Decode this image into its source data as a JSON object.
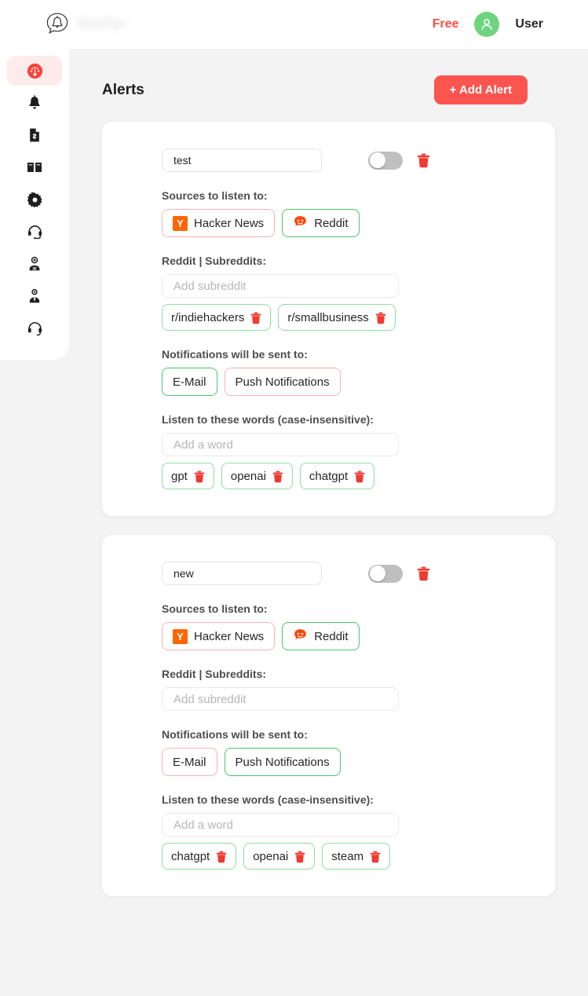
{
  "header": {
    "brand_name": "Notifyr",
    "logo_icon": "bell-in-speech-bubble-icon",
    "plan_label": "Free",
    "user_name": "User",
    "avatar_icon": "user-avatar-icon",
    "avatar_color": "#6fd47f",
    "plan_color": "#fb4e49"
  },
  "sidebar": {
    "items": [
      {
        "name": "dashboard",
        "icon": "gauge-icon",
        "active": true
      },
      {
        "name": "alerts",
        "icon": "bell-icon",
        "active": false
      },
      {
        "name": "billing",
        "icon": "invoice-dollar-icon",
        "active": false
      },
      {
        "name": "docs",
        "icon": "open-book-icon",
        "active": false
      },
      {
        "name": "settings",
        "icon": "gear-icon",
        "active": false
      },
      {
        "name": "support",
        "icon": "headset-icon",
        "active": false
      },
      {
        "name": "bot",
        "icon": "user-robot-icon",
        "active": false
      },
      {
        "name": "account",
        "icon": "user-tie-icon",
        "active": false
      },
      {
        "name": "help",
        "icon": "headphones-icon",
        "active": false
      }
    ]
  },
  "main": {
    "page_title": "Alerts",
    "add_alert_label": "+ Add Alert",
    "add_alert_color": "#fb5550",
    "labels": {
      "sources": "Sources to listen to:",
      "subreddits": "Reddit | Subreddits:",
      "notifications": "Notifications will be sent to:",
      "words": "Listen to these words (case-insensitive):"
    },
    "placeholders": {
      "subreddit": "Add subreddit",
      "word": "Add a word"
    },
    "alerts": [
      {
        "name_value": "test",
        "enabled": false,
        "sources": [
          {
            "label": "Hacker News",
            "icon": "hacker-news-icon",
            "selected": false
          },
          {
            "label": "Reddit",
            "icon": "reddit-icon",
            "selected": true
          }
        ],
        "subreddits": [
          "r/indiehackers",
          "r/smallbusiness"
        ],
        "notifications": [
          {
            "label": "E-Mail",
            "selected": true
          },
          {
            "label": "Push Notifications",
            "selected": false
          }
        ],
        "words": [
          "gpt",
          "openai",
          "chatgpt"
        ]
      },
      {
        "name_value": "new",
        "enabled": false,
        "sources": [
          {
            "label": "Hacker News",
            "icon": "hacker-news-icon",
            "selected": false
          },
          {
            "label": "Reddit",
            "icon": "reddit-icon",
            "selected": true
          }
        ],
        "subreddits": [],
        "notifications": [
          {
            "label": "E-Mail",
            "selected": false
          },
          {
            "label": "Push Notifications",
            "selected": true
          }
        ],
        "words": [
          "chatgpt",
          "openai",
          "steam"
        ]
      }
    ]
  }
}
